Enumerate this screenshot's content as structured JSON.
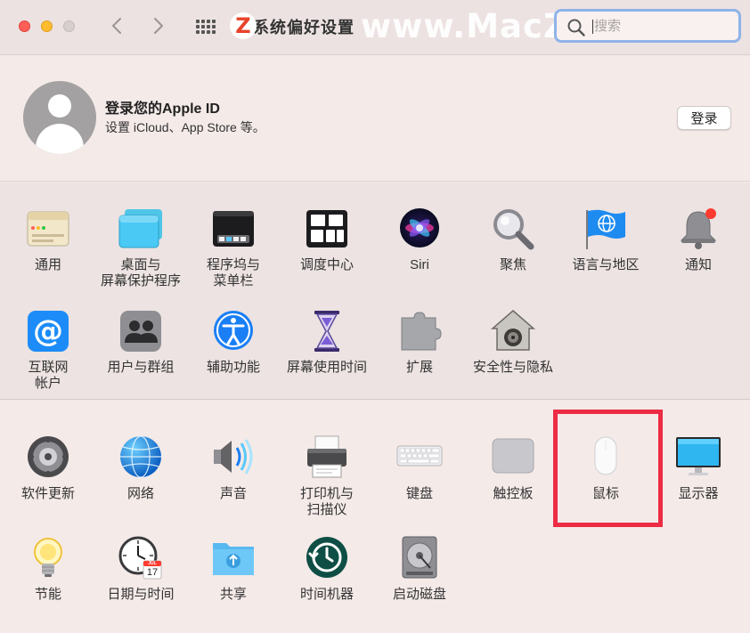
{
  "window": {
    "title": "系统偏好设置",
    "watermark": "www.MacZ.com",
    "watermark_logo": "Z"
  },
  "search": {
    "placeholder": "搜索",
    "value": ""
  },
  "account": {
    "title": "登录您的Apple ID",
    "subtitle": "设置 iCloud、App Store 等。",
    "login_button": "登录"
  },
  "section1": [
    {
      "id": "general",
      "label": "通用",
      "icon": "general-icon"
    },
    {
      "id": "desktop",
      "label": "桌面与\n屏幕保护程序",
      "icon": "desktop-screensaver-icon"
    },
    {
      "id": "dock",
      "label": "程序坞与\n菜单栏",
      "icon": "dock-menubar-icon"
    },
    {
      "id": "mission",
      "label": "调度中心",
      "icon": "mission-control-icon"
    },
    {
      "id": "siri",
      "label": "Siri",
      "icon": "siri-icon"
    },
    {
      "id": "spotlight",
      "label": "聚焦",
      "icon": "spotlight-icon"
    },
    {
      "id": "language",
      "label": "语言与地区",
      "icon": "language-region-icon"
    },
    {
      "id": "notifications",
      "label": "通知",
      "icon": "notifications-icon"
    },
    {
      "id": "internet",
      "label": "互联网\n帐户",
      "icon": "internet-accounts-icon"
    },
    {
      "id": "users",
      "label": "用户与群组",
      "icon": "users-groups-icon"
    },
    {
      "id": "accessibility",
      "label": "辅助功能",
      "icon": "accessibility-icon"
    },
    {
      "id": "screentime",
      "label": "屏幕使用时间",
      "icon": "screen-time-icon"
    },
    {
      "id": "extensions",
      "label": "扩展",
      "icon": "extensions-icon"
    },
    {
      "id": "security",
      "label": "安全性与隐私",
      "icon": "security-privacy-icon"
    }
  ],
  "section2": [
    {
      "id": "update",
      "label": "软件更新",
      "icon": "software-update-icon"
    },
    {
      "id": "network",
      "label": "网络",
      "icon": "network-icon"
    },
    {
      "id": "sound",
      "label": "声音",
      "icon": "sound-icon"
    },
    {
      "id": "printers",
      "label": "打印机与\n扫描仪",
      "icon": "printers-scanners-icon"
    },
    {
      "id": "keyboard",
      "label": "键盘",
      "icon": "keyboard-icon"
    },
    {
      "id": "trackpad",
      "label": "触控板",
      "icon": "trackpad-icon"
    },
    {
      "id": "mouse",
      "label": "鼠标",
      "icon": "mouse-icon"
    },
    {
      "id": "displays",
      "label": "显示器",
      "icon": "displays-icon"
    },
    {
      "id": "energy",
      "label": "节能",
      "icon": "energy-saver-icon"
    },
    {
      "id": "datetime",
      "label": "日期与时间",
      "icon": "date-time-icon",
      "calendar_month": "JUL",
      "calendar_day": "17"
    },
    {
      "id": "sharing",
      "label": "共享",
      "icon": "sharing-icon"
    },
    {
      "id": "timemachine",
      "label": "时间机器",
      "icon": "time-machine-icon"
    },
    {
      "id": "startup",
      "label": "启动磁盘",
      "icon": "startup-disk-icon"
    }
  ],
  "highlighted_item": "mouse",
  "colors": {
    "highlight": "#ec2c44",
    "search_focus": "#8fb3e9",
    "traffic_red": "#fe5f57",
    "traffic_yellow": "#febc2e"
  }
}
